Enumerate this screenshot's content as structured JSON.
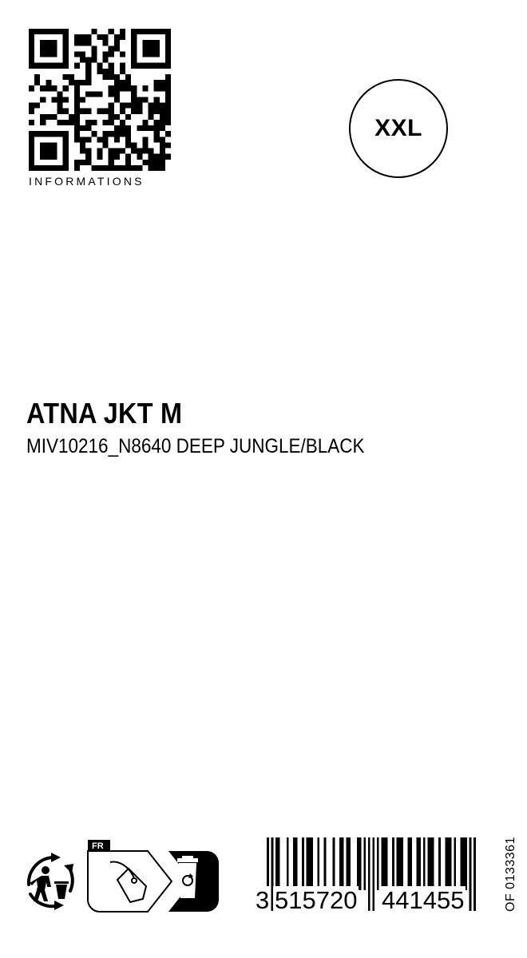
{
  "qr": {
    "caption": "INFORMATIONS"
  },
  "size": {
    "value": "XXL"
  },
  "product": {
    "name": "ATNA JKT M",
    "reference": "MIV10216_N8640 DEEP JUNGLE/BLACK"
  },
  "sorting_info": {
    "country": "FR",
    "icons": [
      "triman-recycling-icon",
      "price-tag-icon",
      "recycling-bin-icon"
    ]
  },
  "barcode": {
    "first_digit": "3",
    "left_group": "515720",
    "right_group": "441455"
  },
  "label_code": "OF 0133361",
  "colors": {
    "ink": "#000000",
    "paper": "#ffffff"
  }
}
